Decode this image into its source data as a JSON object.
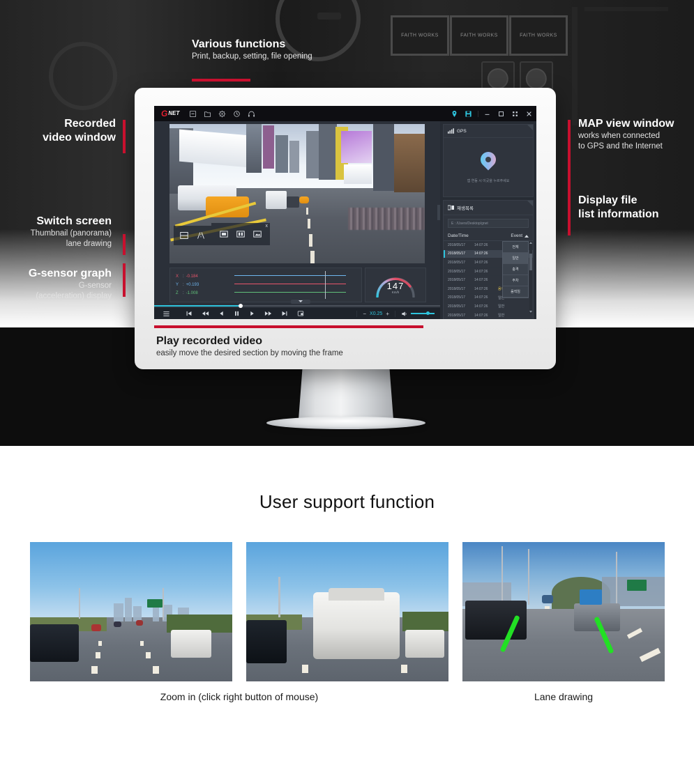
{
  "annotations": {
    "various_functions": {
      "title": "Various functions",
      "subtitle": "Print, backup, setting, file opening"
    },
    "recorded_video": {
      "title_line1": "Recorded",
      "title_line2": "video window"
    },
    "switch_screen": {
      "title": "Switch screen",
      "sub_line1": "Thumbnail (panorama)",
      "sub_line2": "lane drawing"
    },
    "gsensor_graph": {
      "title": "G-sensor graph",
      "sub_line1": "G-sensor",
      "sub_line2": "(acceleration) display"
    },
    "map_view": {
      "title": "MAP view window",
      "sub_line1": "works when connected",
      "sub_line2": "to GPS and the Internet"
    },
    "display_file": {
      "title_line1": "Display file",
      "title_line2": "list information"
    },
    "play_recorded": {
      "title": "Play recorded video",
      "subtitle": "easily move the desired section by moving the frame"
    }
  },
  "app": {
    "logo": {
      "g": "G",
      "net": "NET"
    },
    "toolbar_icons": [
      "print-icon",
      "folder-open-icon",
      "settings-icon",
      "clock-icon",
      "headphone-icon"
    ],
    "titlebar_right_icons": [
      "map-pin-icon",
      "save-icon"
    ],
    "window_buttons": [
      "minimize-button",
      "maximize-button",
      "fullscreen-button",
      "close-button"
    ],
    "video_overlay": {
      "left_buttons": [
        "split-screen-icon",
        "lane-drawing-icon"
      ],
      "popup_buttons": [
        "single-view-icon",
        "dual-view-icon",
        "panorama-view-icon"
      ],
      "close_label": "x"
    },
    "gsensor": {
      "axes": [
        {
          "label": "X",
          "sep": ":",
          "value": "-0.184",
          "color": "#e8556b"
        },
        {
          "label": "Y",
          "sep": ":",
          "value": "+0.193",
          "color": "#6fb6f0"
        },
        {
          "label": "Z",
          "sep": ":",
          "value": "-1.008",
          "color": "#61c07a"
        }
      ]
    },
    "speedometer": {
      "value": "147",
      "unit": "Km/h"
    },
    "controls": {
      "menu_icon": "hamburger-menu-icon",
      "buttons": [
        "skip-to-start-icon",
        "rewind-icon",
        "step-back-icon",
        "pause-icon",
        "play-icon",
        "fast-forward-icon",
        "skip-to-end-icon",
        "capture-icon"
      ],
      "speed_minus": "−",
      "speed_value": "X0.25",
      "speed_plus": "+",
      "volume_icon": "volume-icon"
    },
    "gps_panel": {
      "icon": "signal-bars-icon",
      "title": "GPS",
      "pin_icon": "map-pin-icon",
      "hint": "앱 연동 시 이곳을 누르주세요"
    },
    "playlist_panel": {
      "icon": "playlist-icon",
      "title": "재생목록",
      "path_value": "E : /Users/Desktop/gnet",
      "columns": {
        "datetime": "Date/Time",
        "event": "Event"
      },
      "sort_icon": "caret-up-icon",
      "event_filter_options": [
        "전체",
        "일반",
        "충격",
        "주차",
        "움직임"
      ],
      "event_filter_selected": "일반",
      "rows": [
        {
          "date": "2018/05/17",
          "time": "14:07:26",
          "event": "",
          "selected": false
        },
        {
          "date": "2018/05/17",
          "time": "14:07:26",
          "event": "",
          "selected": true
        },
        {
          "date": "2018/05/17",
          "time": "14:07:26",
          "event": "",
          "selected": false
        },
        {
          "date": "2018/05/17",
          "time": "14:07:26",
          "event": "",
          "selected": false
        },
        {
          "date": "2018/05/17",
          "time": "14:07:26",
          "event": "",
          "selected": false
        },
        {
          "date": "2018/05/17",
          "time": "14:07:26",
          "event": "움직임",
          "selected": false,
          "motion": true
        },
        {
          "date": "2018/05/17",
          "time": "14:07:26",
          "event": "일반",
          "selected": false
        },
        {
          "date": "2018/05/17",
          "time": "14:07:26",
          "event": "일반",
          "selected": false
        },
        {
          "date": "2018/05/17",
          "time": "14:07:26",
          "event": "일반",
          "selected": false
        }
      ]
    }
  },
  "support": {
    "section_title": "User support function",
    "captions": {
      "zoom_in": "Zoom in (click right button of mouse)",
      "lane_drawing": "Lane drawing"
    }
  },
  "colors": {
    "accent_red": "#c8102e",
    "accent_teal": "#2ec4dd",
    "app_bg": "#2b3039",
    "titlebar_bg": "#0e0e12",
    "motion_yellow": "#e3c54d",
    "lane_green": "#22e024"
  },
  "studio_frames": [
    "FAITH WORKS",
    "FAITH WORKS",
    "FAITH WORKS"
  ]
}
